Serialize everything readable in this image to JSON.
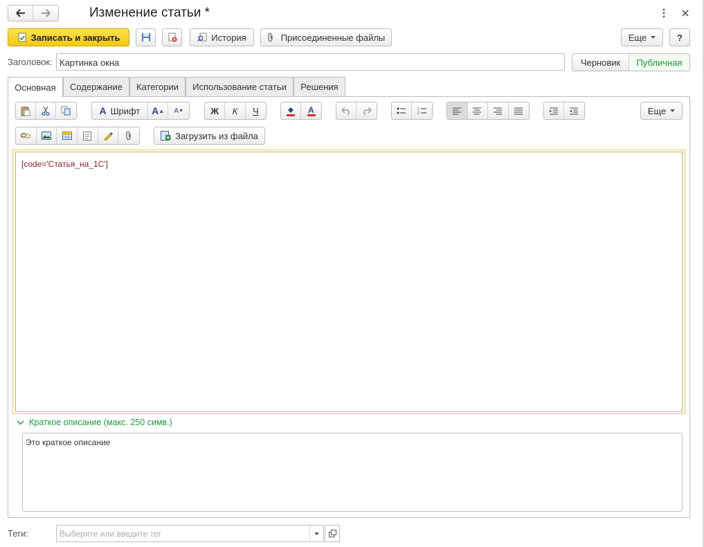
{
  "window": {
    "title": "Изменение статьи *",
    "icons": {
      "back": "arrow-left-icon",
      "forward": "arrow-right-icon",
      "more": "vertical-dots-icon",
      "close": "close-icon"
    }
  },
  "command_bar": {
    "save_close": "Записать и закрыть",
    "history": "История",
    "attached_files": "Присоединенные файлы",
    "more": "Еще",
    "help": "?"
  },
  "header_field": {
    "label": "Заголовок:",
    "value": "Картинка окна",
    "status_draft": "Черновик",
    "status_public": "Публичная"
  },
  "tabs": [
    {
      "label": "Основная",
      "active": true
    },
    {
      "label": "Содержание",
      "active": false
    },
    {
      "label": "Категории",
      "active": false
    },
    {
      "label": "Использование статьи",
      "active": false
    },
    {
      "label": "Решения",
      "active": false
    }
  ],
  "editor_toolbar": {
    "font": "Шрифт",
    "bold": "Ж",
    "italic": "К",
    "underline": "Ч",
    "more": "Еще",
    "load_from_file": "Загрузить из файла"
  },
  "editor": {
    "content": "[code='Статья_на_1С']"
  },
  "short_description": {
    "title": "Краткое описание (макс. 250 симв.)",
    "value": "Это краткое описание"
  },
  "tags": {
    "label": "Теги:",
    "placeholder": "Выберите или введите тег"
  },
  "colors": {
    "primary_button": "#f7d21a",
    "accent_green": "#1a9a3a",
    "editor_border": "#e6c65a",
    "code_text": "#8b1a1a"
  }
}
